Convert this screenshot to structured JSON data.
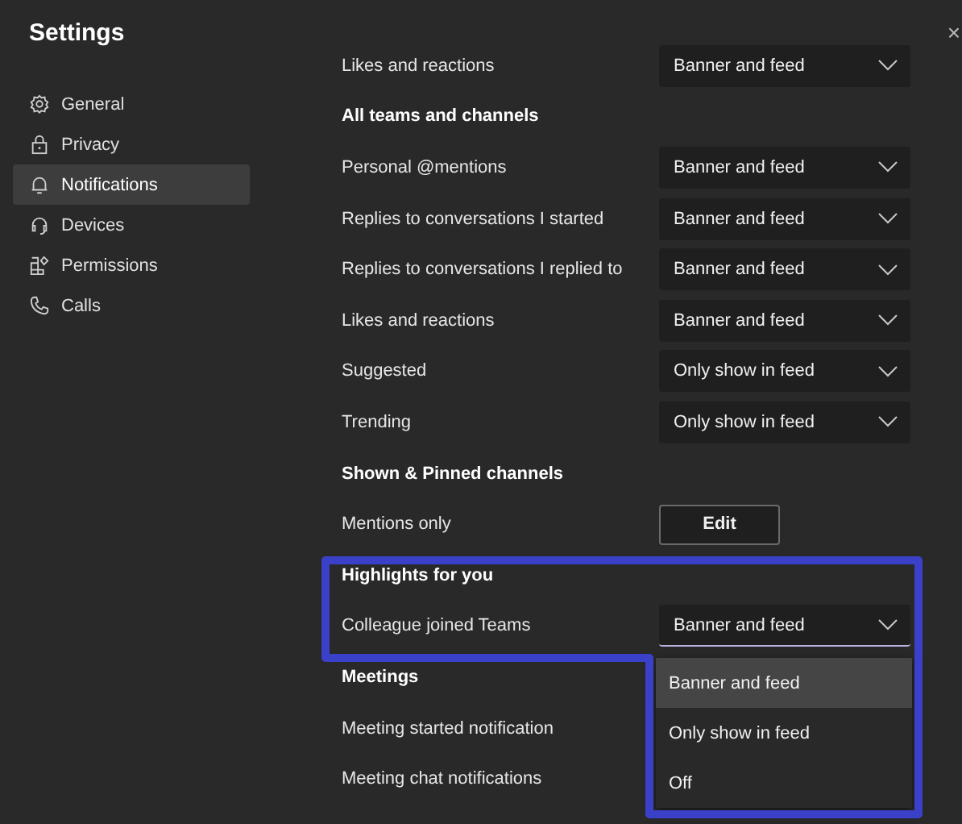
{
  "window": {
    "title": "Settings",
    "close": "×"
  },
  "sidebar": {
    "items": [
      {
        "label": "General",
        "selected": false
      },
      {
        "label": "Privacy",
        "selected": false
      },
      {
        "label": "Notifications",
        "selected": true
      },
      {
        "label": "Devices",
        "selected": false
      },
      {
        "label": "Permissions",
        "selected": false
      },
      {
        "label": "Calls",
        "selected": false
      }
    ]
  },
  "sections": [
    {
      "rows": [
        {
          "kind": "dropdown",
          "label": "Likes and reactions",
          "value": "Banner and feed"
        }
      ]
    },
    {
      "heading": "All teams and channels",
      "rows": [
        {
          "kind": "dropdown",
          "label": "Personal @mentions",
          "value": "Banner and feed"
        },
        {
          "kind": "dropdown",
          "label": "Replies to conversations I started",
          "value": "Banner and feed"
        },
        {
          "kind": "dropdown",
          "label": "Replies to conversations I replied to",
          "value": "Banner and feed"
        },
        {
          "kind": "dropdown",
          "label": "Likes and reactions",
          "value": "Banner and feed"
        },
        {
          "kind": "dropdown",
          "label": "Suggested",
          "value": "Only show in feed"
        },
        {
          "kind": "dropdown",
          "label": "Trending",
          "value": "Only show in feed"
        }
      ]
    },
    {
      "heading": "Shown & Pinned channels",
      "rows": [
        {
          "kind": "button",
          "label": "Mentions only",
          "value": "Edit"
        }
      ]
    },
    {
      "heading": "Highlights for you",
      "rows": [
        {
          "kind": "dropdown",
          "label": "Colleague joined Teams",
          "value": "Banner and feed",
          "expanded": true,
          "options": [
            {
              "label": "Banner and feed",
              "selected": true
            },
            {
              "label": "Only show in feed",
              "selected": false
            },
            {
              "label": "Off",
              "selected": false
            }
          ]
        }
      ]
    },
    {
      "heading": "Meetings",
      "rows": [
        {
          "kind": "label",
          "label": "Meeting started notification"
        },
        {
          "kind": "label",
          "label": "Meeting chat notifications"
        }
      ]
    }
  ]
}
